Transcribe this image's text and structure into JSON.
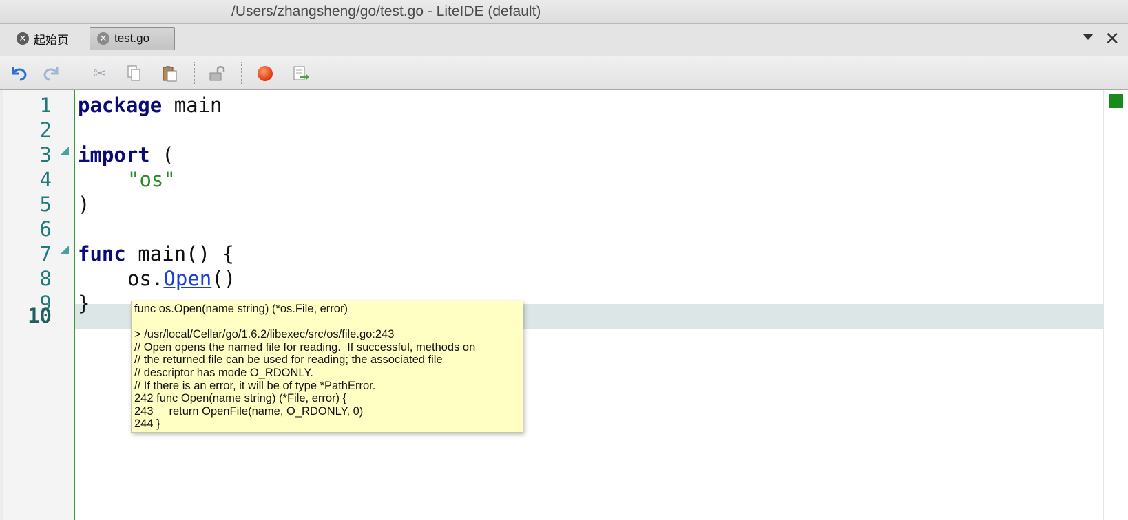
{
  "window": {
    "title": "/Users/zhangsheng/go/test.go - LiteIDE (default)"
  },
  "tabs": [
    {
      "label": "起始页",
      "active": false
    },
    {
      "label": "test.go",
      "active": true
    }
  ],
  "tabbar": {
    "menu_icon": "chevron-down-icon",
    "close_glyph": "✕"
  },
  "toolbar": {
    "buttons": [
      {
        "name": "undo-icon",
        "glyph": "↶",
        "color": "#2a6fd6"
      },
      {
        "name": "redo-icon",
        "glyph": "↷",
        "color": "#9fb6d8"
      },
      {
        "name": "cut-icon",
        "glyph": "✂",
        "color": "#9aa6b4"
      },
      {
        "name": "copy-icon",
        "glyph": "❐",
        "color": "#a8a8a8"
      },
      {
        "name": "paste-icon",
        "glyph": "📋",
        "color": "#8a6a3a"
      },
      {
        "name": "lock-icon",
        "glyph": "🔓",
        "color": "#a0a0a0"
      },
      {
        "name": "record-icon",
        "glyph": "●",
        "color": "#e34a1a"
      },
      {
        "name": "export-icon",
        "glyph": "🖹",
        "color": "#6a8a5a"
      }
    ]
  },
  "editor": {
    "line_numbers": [
      "1",
      "2",
      "3",
      "4",
      "5",
      "6",
      "7",
      "8",
      "9",
      "10"
    ],
    "current_line": "10",
    "code": {
      "l1_kw": "package",
      "l1_rest": " main",
      "l3_kw": "import",
      "l3_rest": " (",
      "l4_str": "\"os\"",
      "l5": ")",
      "l7_kw": "func",
      "l7_rest": " main() {",
      "l8_pre": "os.",
      "l8_link": "Open",
      "l8_post": "()",
      "l9": "}"
    },
    "colors": {
      "keyword": "#0a0a78",
      "string": "#2a8a2a",
      "link": "#1a3de0",
      "line_number": "#1f7a7a",
      "current_line_bg": "#dde6e6"
    }
  },
  "tooltip": {
    "lines": [
      "func os.Open(name string) (*os.File, error)",
      "",
      "> /usr/local/Cellar/go/1.6.2/libexec/src/os/file.go:243",
      "// Open opens the named file for reading.  If successful, methods on",
      "// the returned file can be used for reading; the associated file",
      "// descriptor has mode O_RDONLY.",
      "// If there is an error, it will be of type *PathError.",
      "242 func Open(name string) (*File, error) {",
      "243     return OpenFile(name, O_RDONLY, 0)",
      "244 }"
    ]
  }
}
